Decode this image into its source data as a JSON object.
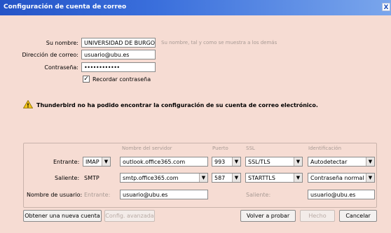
{
  "window": {
    "title": "Configuración de cuenta de correo",
    "close_glyph": "X"
  },
  "form": {
    "name_label": "Su nombre:",
    "name_value": "UNIVERSIDAD DE BURGOS",
    "name_hint": "Su nombre, tal y como se muestra a los demás",
    "email_label": "Dirección de correo:",
    "email_value": "usuario@ubu.es",
    "password_label": "Contraseña:",
    "password_value": "••••••••••••",
    "remember_label": "Recordar contraseña",
    "remember_checked": true,
    "remember_check_glyph": "✓"
  },
  "warning": {
    "text": "Thunderbird no ha podido encontrar la configuración de su cuenta de correo electrónico.",
    "icon": "warning-triangle-icon",
    "icon_glyph": "!"
  },
  "server_table": {
    "headers": {
      "server": "Nombre del servidor",
      "port": "Puerto",
      "ssl": "SSL",
      "auth": "Identificación"
    },
    "incoming": {
      "label": "Entrante:",
      "protocol": "IMAP",
      "server": "outlook.office365.com",
      "port": "993",
      "ssl": "SSL/TLS",
      "auth": "Autodetectar"
    },
    "outgoing": {
      "label": "Saliente:",
      "protocol": "SMTP",
      "server": "smtp.office365.com",
      "port": "587",
      "ssl": "STARTTLS",
      "auth": "Contraseña normal"
    },
    "username": {
      "label": "Nombre de usuario:",
      "incoming_label": "Entrante:",
      "incoming_value": "usuario@ubu.es",
      "outgoing_label": "Saliente:",
      "outgoing_value": "usuario@ubu.es"
    },
    "dropdown_glyph": "▼"
  },
  "buttons": {
    "new_account": "Obtener una nueva cuenta",
    "advanced": "Config. avanzada",
    "retest": "Volver a probar",
    "done": "Hecho",
    "cancel": "Cancelar"
  },
  "colors": {
    "background": "#f6dcd3",
    "titlebar": "#2554c7",
    "disabled_text": "#b8aaa4"
  }
}
